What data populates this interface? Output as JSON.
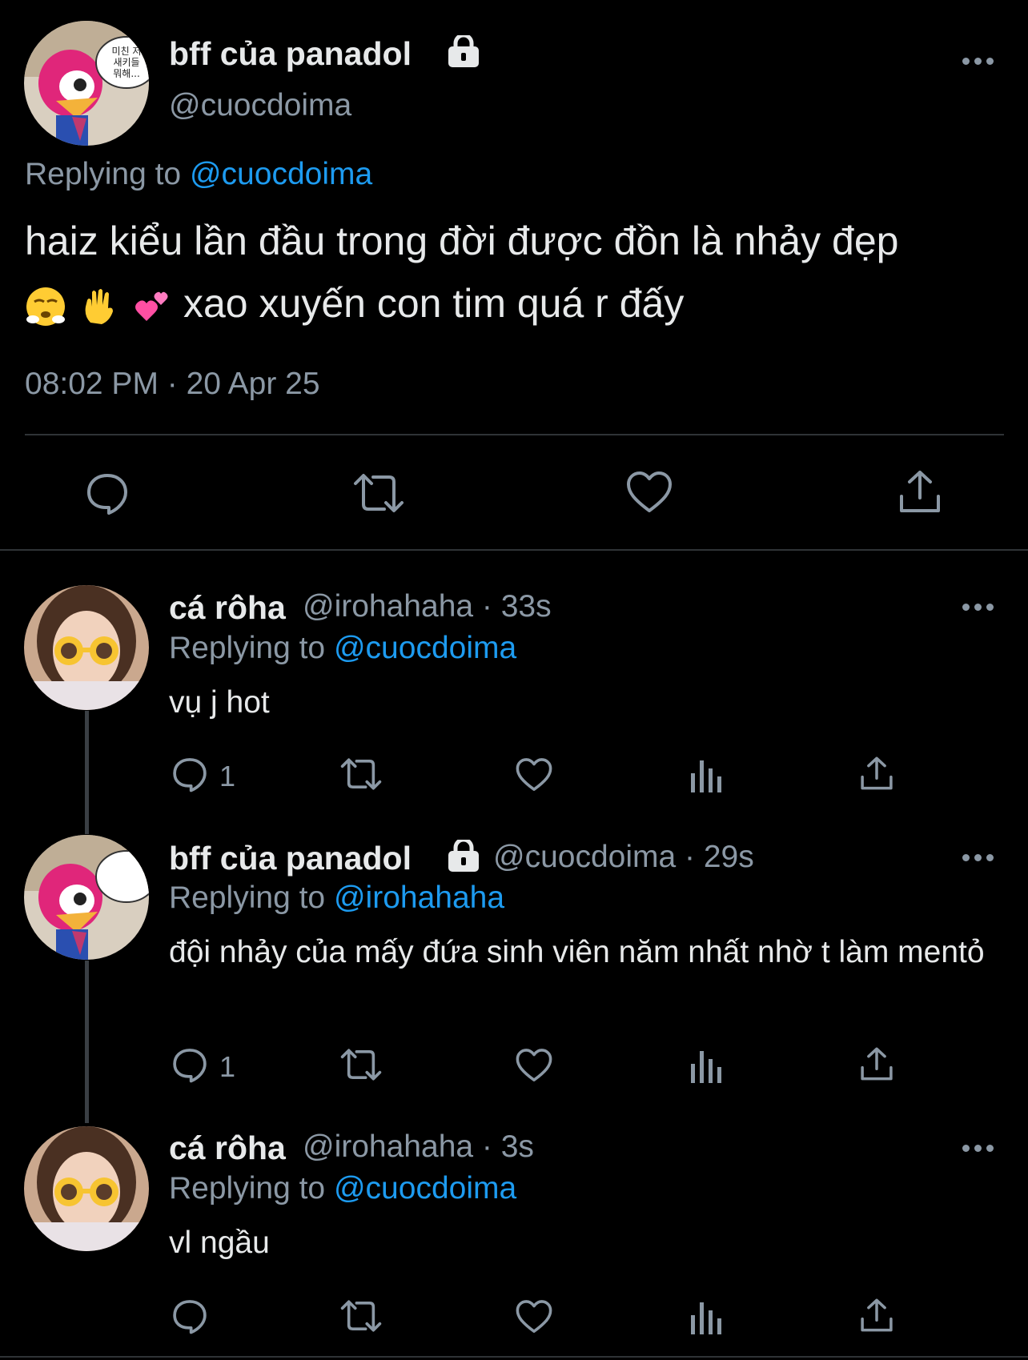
{
  "main_tweet": {
    "display_name": "bff của panadol",
    "handle": "@cuocdoima",
    "replying_prefix": "Replying to",
    "replying_to": "@cuocdoima",
    "text_line1": "haiz kiểu lần đầu trong đời được đồn là nhảy đẹp",
    "text_line2": "xao xuyến con tim quá r đấy",
    "emojis": [
      "huffing-face",
      "raised-hand",
      "two-hearts"
    ],
    "timestamp": "08:02 PM · 20 Apr 25",
    "avatar_speech_text": "미친 저 새키들 뭐해..."
  },
  "replies": [
    {
      "display_name": "cá rôha",
      "handle": "@irohahaha · 33s",
      "replying_prefix": "Replying to",
      "replying_to": "@cuocdoima",
      "text": "vụ j hot",
      "reply_count": "1"
    },
    {
      "display_name": "bff của panadol",
      "handle": "@cuocdoima · 29s",
      "replying_prefix": "Replying to",
      "replying_to": "@irohahaha",
      "text": "đội nhảy của mấy đứa sinh viên năm nhất nhờ t làm mentỏ",
      "reply_count": "1"
    },
    {
      "display_name": "cá rôha",
      "handle": "@irohahaha · 3s",
      "replying_prefix": "Replying to",
      "replying_to": "@cuocdoima",
      "text": "vl ngầu",
      "reply_count": ""
    }
  ],
  "colors": {
    "background": "#000000",
    "text": "#e7e9ea",
    "muted": "#8b98a5",
    "accent": "#1d9bf0",
    "divider": "#2f3336"
  },
  "icons": [
    "reply-icon",
    "retweet-icon",
    "like-icon",
    "share-icon",
    "views-icon",
    "more-icon",
    "lock-icon"
  ]
}
